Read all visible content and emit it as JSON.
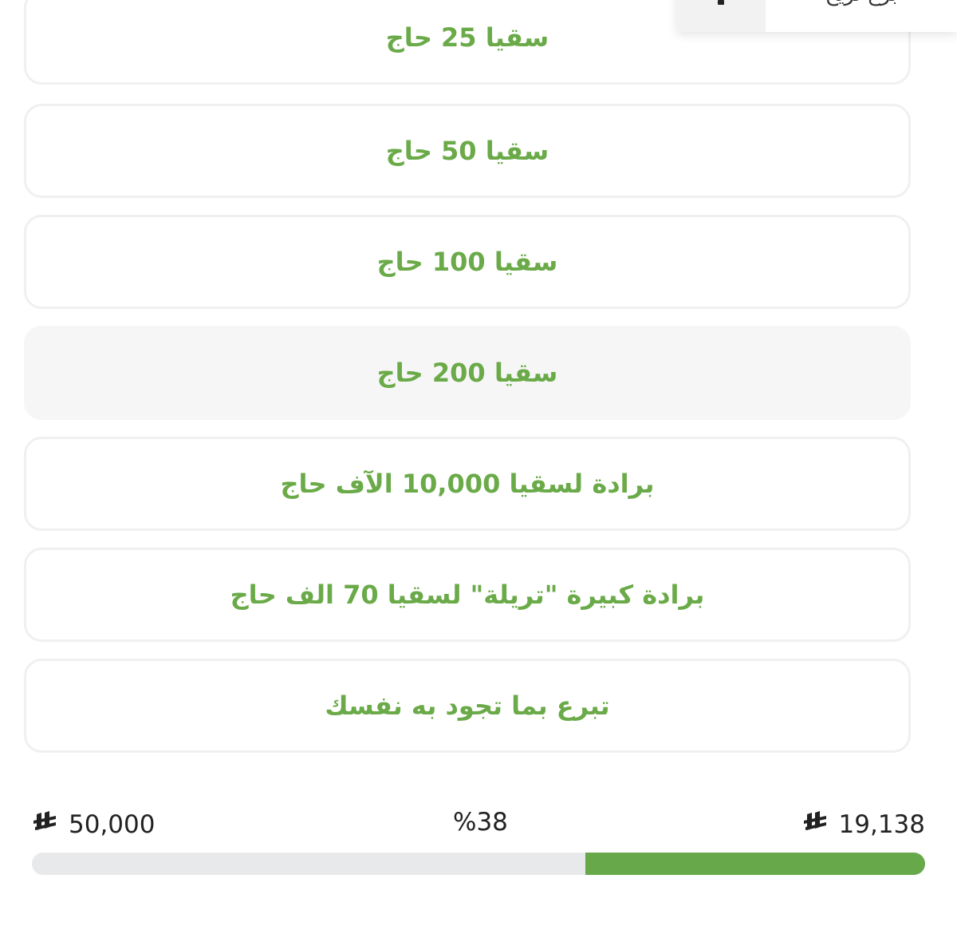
{
  "header_popup": {
    "label": "برع تريح"
  },
  "options": [
    {
      "label": "سقيا 25 حاج",
      "selected": false
    },
    {
      "label": "سقيا 50 حاج",
      "selected": false
    },
    {
      "label": "سقيا 100 حاج",
      "selected": false
    },
    {
      "label": "سقيا 200 حاج",
      "selected": true
    },
    {
      "label": "برادة لسقيا 10,000 الآف حاج",
      "selected": false
    },
    {
      "label": "برادة كبيرة \"تريلة\" لسقيا 70 الف حاج",
      "selected": false
    },
    {
      "label": "تبرع بما تجود به نفسك",
      "selected": false
    }
  ],
  "progress": {
    "goal": "50,000",
    "raised": "19,138",
    "percent_label": "%38",
    "percent_value": 38,
    "currency_icon": "riyal-icon"
  },
  "colors": {
    "accent": "#6aaa48",
    "progress_fill": "#67a84b",
    "progress_track": "#e8e9eb",
    "card_border": "#f0f0f0",
    "selected_bg": "#f6f6f6"
  }
}
